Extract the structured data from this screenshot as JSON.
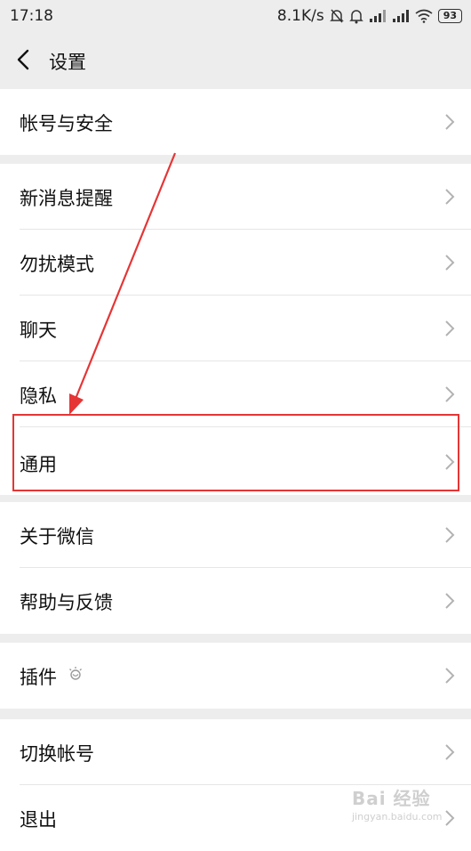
{
  "status_bar": {
    "time": "17:18",
    "net_speed": "8.1K/s",
    "battery": "93"
  },
  "header": {
    "title": "设置"
  },
  "groups": [
    {
      "items": [
        {
          "label": "帐号与安全"
        }
      ]
    },
    {
      "items": [
        {
          "label": "新消息提醒"
        },
        {
          "label": "勿扰模式"
        },
        {
          "label": "聊天"
        },
        {
          "label": "隐私"
        },
        {
          "label": "通用"
        }
      ]
    },
    {
      "items": [
        {
          "label": "关于微信"
        },
        {
          "label": "帮助与反馈"
        }
      ]
    },
    {
      "items": [
        {
          "label": "插件"
        }
      ]
    },
    {
      "items": [
        {
          "label": "切换帐号"
        },
        {
          "label": "退出"
        }
      ]
    }
  ],
  "annotation": {
    "highlight_color": "#e53535",
    "target_item": "通用"
  },
  "watermark": {
    "logo": "Bai 经验",
    "site": "jingyan.baidu.com"
  },
  "icons": {
    "back": "chevron-left-icon",
    "row_arrow": "chevron-right-icon",
    "plugin": "bulb-icon"
  }
}
